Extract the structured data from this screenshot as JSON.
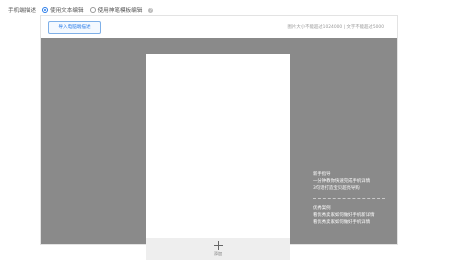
{
  "mode": {
    "label": "手机端描述",
    "option_text": "使用文本编辑",
    "option_template": "使用神笔模板编辑",
    "selected": "text",
    "help_icon": "question-circle-icon"
  },
  "toolbar": {
    "import_label": "导入电脑端描述",
    "hint": "图片大小不能超过1024000 | 文字不能超过5000"
  },
  "canvas": {
    "add_icon": "plus-icon",
    "add_label": "添加"
  },
  "side": {
    "guide_title": "新手指导",
    "guide_link1": "一分钟教你快速完成手机详情",
    "guide_link2": "3句话打造宝贝超亮导购",
    "case_title": "优秀案例",
    "case_link1": "看优秀卖家如何做好手机新详情",
    "case_link2": "看优秀卖家如何做好手机详情"
  },
  "colors": {
    "accent": "#2b7de9",
    "canvas_bg": "#8a8a8a",
    "add_area_bg": "#eeeeee"
  }
}
